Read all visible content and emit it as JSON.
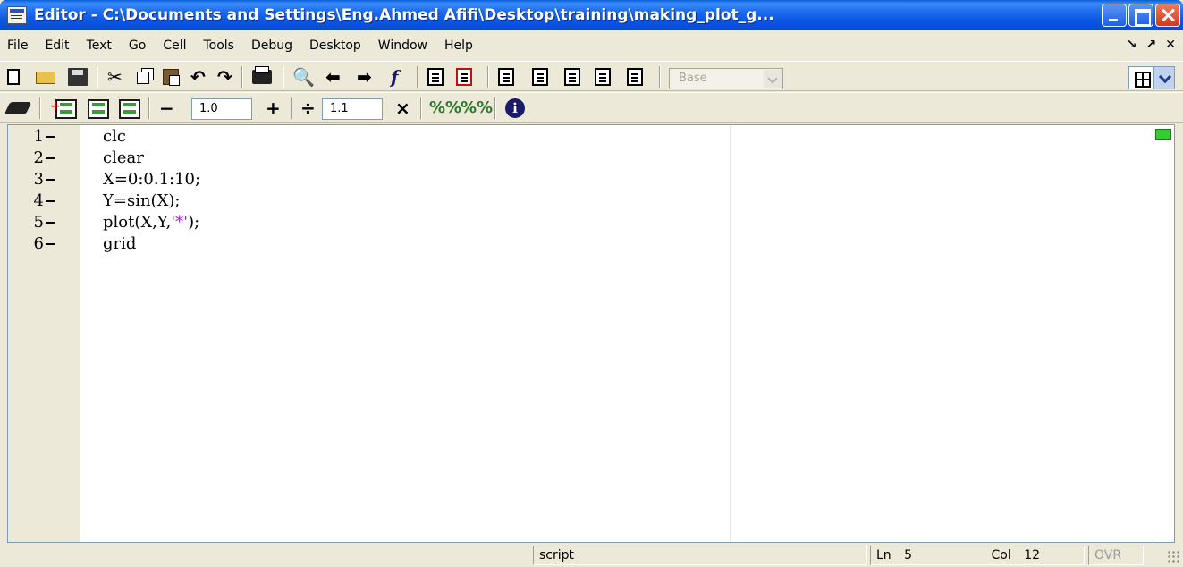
{
  "window": {
    "title": "Editor - C:\\Documents and Settings\\Eng.Ahmed Afifi\\Desktop\\training\\making_plot_g..."
  },
  "menu": {
    "items": [
      "File",
      "Edit",
      "Text",
      "Go",
      "Cell",
      "Tools",
      "Debug",
      "Desktop",
      "Window",
      "Help"
    ]
  },
  "toolbar": {
    "base_label": "Base",
    "cut_glyph": "✂",
    "undo_glyph": "↶",
    "redo_glyph": "↷",
    "find_glyph": "🔍",
    "back_glyph": "⬅",
    "forward_glyph": "➡",
    "function_glyph": "f",
    "icons": [
      "new-file-icon",
      "open-file-icon",
      "save-icon",
      "cut-icon",
      "copy-icon",
      "paste-icon",
      "undo-icon",
      "redo-icon",
      "print-icon",
      "find-icon",
      "back-icon",
      "forward-icon",
      "function-icon"
    ]
  },
  "cell_toolbar": {
    "decrement_glyph": "−",
    "increment_glyph": "+",
    "divide_glyph": "÷",
    "multiply_glyph": "×",
    "pct_glyph": "%%",
    "info_glyph": "i",
    "value_one": "1.0",
    "value_two": "1.1"
  },
  "editor": {
    "lines": [
      {
        "number": "1",
        "code": "clc"
      },
      {
        "number": "2",
        "code": "clear"
      },
      {
        "number": "3",
        "code": "X=0:0.1:10;"
      },
      {
        "number": "4",
        "code": "Y=sin(X);"
      },
      {
        "number": "5",
        "code_before": "plot(X,Y,",
        "code_string": "'*'",
        "code_after": ");"
      },
      {
        "number": "6",
        "code": "grid"
      }
    ],
    "string_color": "#a020f0",
    "status_color": "#33cc33"
  },
  "statusbar": {
    "mode": "script",
    "line_label": "Ln",
    "line_value": "5",
    "col_label": "Col",
    "col_value": "12",
    "overwrite": "OVR"
  }
}
